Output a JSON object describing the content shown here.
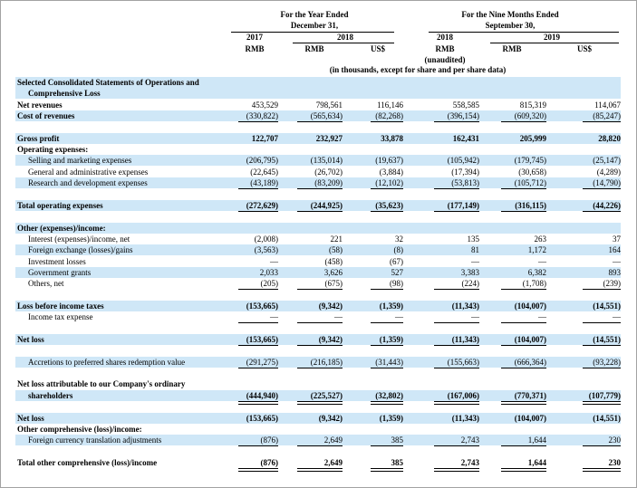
{
  "header": {
    "period_year_line1": "For the Year Ended",
    "period_year_line2": "December 31,",
    "period_nine_line1": "For the Nine Months Ended",
    "period_nine_line2": "September 30,",
    "years": [
      "2017",
      "2018",
      "2018",
      "2019"
    ],
    "currencies": [
      "RMB",
      "RMB",
      "US$",
      "RMB",
      "RMB",
      "US$"
    ],
    "unaudited": "(unaudited)",
    "note": "(in thousands, except for share and per share data)"
  },
  "rows": [
    {
      "label": "Selected Consolidated Statements of Operations and",
      "bold": true,
      "hl": true,
      "values": []
    },
    {
      "label": "Comprehensive Loss",
      "bold": true,
      "hl": true,
      "indent": 1,
      "values": []
    },
    {
      "label": "Net revenues",
      "bold": true,
      "values": [
        "453,529",
        "798,561",
        "116,146",
        "558,585",
        "815,319",
        "114,067"
      ]
    },
    {
      "label": "Cost of revenues",
      "bold": true,
      "hl": true,
      "values": [
        "(330,822)",
        "(565,634)",
        "(82,268)",
        "(396,154)",
        "(609,320)",
        "(85,247)"
      ],
      "under": "single"
    },
    {
      "label": "",
      "values": []
    },
    {
      "label": "Gross profit",
      "bold": true,
      "hl": true,
      "values": [
        "122,707",
        "232,927",
        "33,878",
        "162,431",
        "205,999",
        "28,820"
      ],
      "bold_values": true
    },
    {
      "label": "Operating expenses:",
      "bold": true,
      "values": []
    },
    {
      "label": "Selling and marketing expenses",
      "hl": true,
      "indent": 1,
      "values": [
        "(206,795)",
        "(135,014)",
        "(19,637)",
        "(105,942)",
        "(179,745)",
        "(25,147)"
      ]
    },
    {
      "label": "General and administrative expenses",
      "indent": 1,
      "values": [
        "(22,645)",
        "(26,702)",
        "(3,884)",
        "(17,394)",
        "(30,658)",
        "(4,289)"
      ]
    },
    {
      "label": "Research and development expenses",
      "hl": true,
      "indent": 1,
      "values": [
        "(43,189)",
        "(83,209)",
        "(12,102)",
        "(53,813)",
        "(105,712)",
        "(14,790)"
      ],
      "under": "single"
    },
    {
      "label": "",
      "values": []
    },
    {
      "label": "Total operating expenses",
      "bold": true,
      "hl": true,
      "values": [
        "(272,629)",
        "(244,925)",
        "(35,623)",
        "(177,149)",
        "(316,115)",
        "(44,226)"
      ],
      "bold_values": true,
      "under": "single"
    },
    {
      "label": "",
      "values": []
    },
    {
      "label": "Other (expenses)/income:",
      "bold": true,
      "hl": true,
      "values": []
    },
    {
      "label": "Interest (expenses)/income, net",
      "indent": 1,
      "values": [
        "(2,008)",
        "221",
        "32",
        "135",
        "263",
        "37"
      ]
    },
    {
      "label": "Foreign exchange (losses)/gains",
      "hl": true,
      "indent": 1,
      "values": [
        "(3,563)",
        "(58)",
        "(8)",
        "81",
        "1,172",
        "164"
      ]
    },
    {
      "label": "Investment losses",
      "indent": 1,
      "values": [
        "—",
        "(458)",
        "(67)",
        "—",
        "—",
        "—"
      ]
    },
    {
      "label": "Government grants",
      "hl": true,
      "indent": 1,
      "values": [
        "2,033",
        "3,626",
        "527",
        "3,383",
        "6,382",
        "893"
      ]
    },
    {
      "label": "Others, net",
      "indent": 1,
      "values": [
        "(205)",
        "(675)",
        "(98)",
        "(224)",
        "(1,708)",
        "(239)"
      ],
      "under": "single"
    },
    {
      "label": "",
      "values": []
    },
    {
      "label": "Loss before income taxes",
      "bold": true,
      "hl": true,
      "values": [
        "(153,665)",
        "(9,342)",
        "(1,359)",
        "(11,343)",
        "(104,007)",
        "(14,551)"
      ],
      "bold_values": true
    },
    {
      "label": "Income tax expense",
      "indent": 1,
      "values": [
        "—",
        "—",
        "—",
        "—",
        "—",
        "—"
      ],
      "under": "single"
    },
    {
      "label": "",
      "values": []
    },
    {
      "label": "Net loss",
      "bold": true,
      "hl": true,
      "values": [
        "(153,665)",
        "(9,342)",
        "(1,359)",
        "(11,343)",
        "(104,007)",
        "(14,551)"
      ],
      "bold_values": true,
      "under": "single"
    },
    {
      "label": "",
      "values": []
    },
    {
      "label": "Accretions to preferred shares redemption value",
      "hl": true,
      "indent": 1,
      "values": [
        "(291,275)",
        "(216,185)",
        "(31,443)",
        "(155,663)",
        "(666,364)",
        "(93,228)"
      ],
      "under": "single"
    },
    {
      "label": "",
      "values": []
    },
    {
      "label": "Net loss attributable to our Company's ordinary",
      "bold": true,
      "values": []
    },
    {
      "label": "shareholders",
      "bold": true,
      "hl": true,
      "indent": 1,
      "values": [
        "(444,940)",
        "(225,527)",
        "(32,802)",
        "(167,006)",
        "(770,371)",
        "(107,779)"
      ],
      "bold_values": true,
      "under": "double"
    },
    {
      "label": "",
      "values": []
    },
    {
      "label": "Net loss",
      "bold": true,
      "hl": true,
      "values": [
        "(153,665)",
        "(9,342)",
        "(1,359)",
        "(11,343)",
        "(104,007)",
        "(14,551)"
      ],
      "bold_values": true
    },
    {
      "label": "Other comprehensive (loss)/income:",
      "bold": true,
      "values": []
    },
    {
      "label": "Foreign currency translation adjustments",
      "hl": true,
      "indent": 1,
      "values": [
        "(876)",
        "2,649",
        "385",
        "2,743",
        "1,644",
        "230"
      ],
      "under": "single"
    },
    {
      "label": "",
      "values": []
    },
    {
      "label": "Total other comprehensive (loss)/income",
      "bold": true,
      "values": [
        "(876)",
        "2,649",
        "385",
        "2,743",
        "1,644",
        "230"
      ],
      "bold_values": true,
      "under": "double"
    }
  ]
}
